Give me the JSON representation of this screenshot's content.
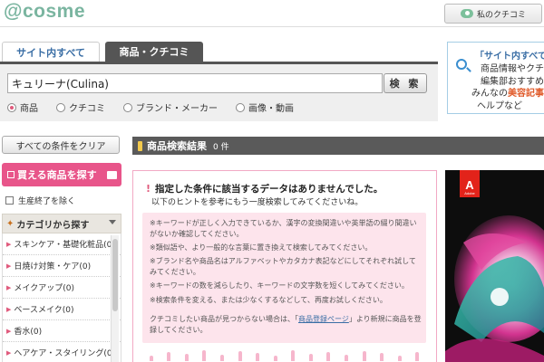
{
  "header": {
    "logo": "@cosme",
    "my_cosme_label": "私のクチコミ"
  },
  "search": {
    "tabs": [
      {
        "label": "サイト内すべて",
        "active": false
      },
      {
        "label": "商品・クチコミ",
        "active": true
      }
    ],
    "query": "キュリーナ(Culina)",
    "button_label": "検 索",
    "radios": [
      {
        "label": "商品",
        "checked": true
      },
      {
        "label": "クチコミ",
        "checked": false
      },
      {
        "label": "ブランド・メーカー",
        "checked": false
      },
      {
        "label": "画像・動画",
        "checked": false
      }
    ]
  },
  "promo": {
    "line1": "「サイト内すべて",
    "line2": "商品情報やクチ",
    "line3": "編集部おすすめ",
    "line4_prefix": "みんなの",
    "line4_highlight": "美容記事",
    "line5": "ヘルプなど"
  },
  "sidebar": {
    "clear_label": "すべての条件をクリア",
    "buyable_label": "買える商品を探す",
    "discontinued_label": "生産終了を除く",
    "category_header": "カテゴリから探す",
    "categories": [
      "スキンケア・基礎化粧品(0)",
      "日焼け対策・ケア(0)",
      "メイクアップ(0)",
      "ベースメイク(0)",
      "香水(0)",
      "ヘアケア・スタイリング(0)"
    ]
  },
  "results": {
    "title": "商品検索結果",
    "count": "0 件"
  },
  "no_results": {
    "title": "指定した条件に該当するデータはありませんでした。",
    "subtitle": "以下のヒントを参考にもう一度検索してみてくださいね。",
    "hints": [
      "※キーワードが正しく入力できているか、漢字の変換間違いや英単語の綴り間違いがないか確認してください。",
      "※類似語や、より一般的な言葉に置き換えて検索してみてください。",
      "※ブランド名や商品名はアルファベットやカタカナ表記などにしてそれぞれ試してみてください。",
      "※キーワードの数を減らしたり、キーワードの文字数を短くしてみてください。",
      "※検索条件を変える、または少なくするなどして、再度お試しください。"
    ],
    "register_prefix": "クチコミしたい商品が見つからない場合は、「",
    "register_link": "商品登録ページ",
    "register_suffix": "」より新規に商品を登録してください。"
  },
  "ad": {
    "brand_letter": "A",
    "brand_name": "Adobe"
  },
  "colors": {
    "brand_green": "#7ab5a0",
    "pink": "#e8558a",
    "dark_bar": "#5a5a5a",
    "link_blue": "#3a6ea5"
  }
}
